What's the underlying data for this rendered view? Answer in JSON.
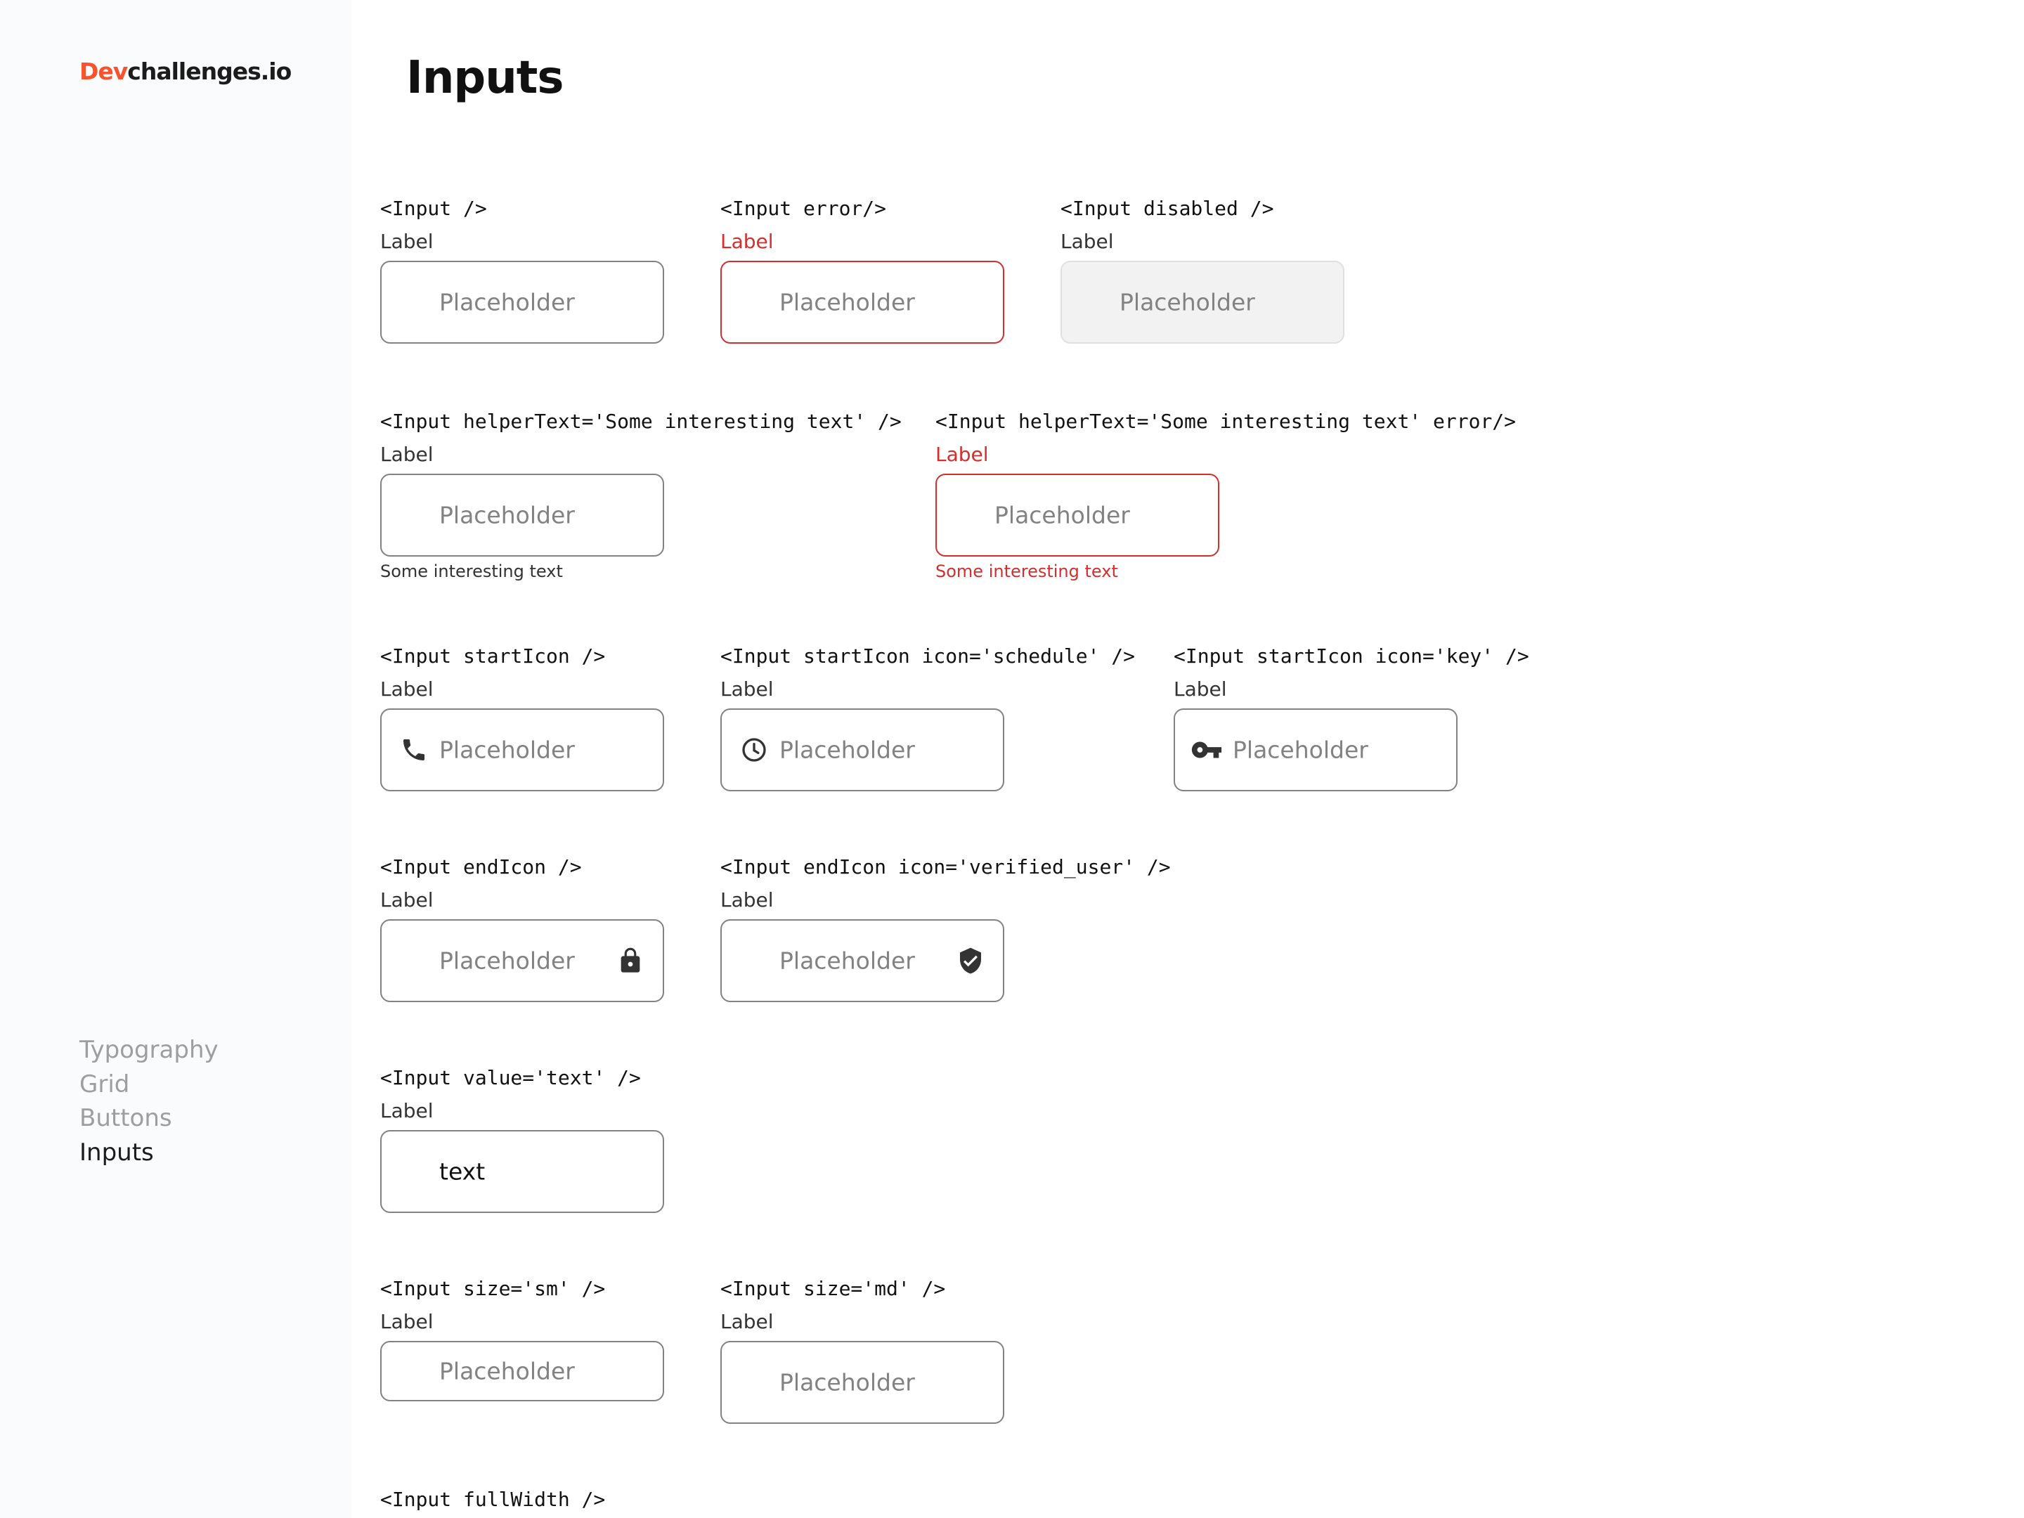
{
  "sidebar": {
    "logo_accent": "Dev",
    "logo_rest": "challenges.io",
    "nav": [
      {
        "label": "Typography"
      },
      {
        "label": "Grid"
      },
      {
        "label": "Buttons"
      },
      {
        "label": "Inputs"
      }
    ],
    "active_item": "Inputs"
  },
  "page": {
    "title": "Inputs"
  },
  "demos": {
    "basic": {
      "code": "<Input />",
      "label": "Label",
      "placeholder": "Placeholder"
    },
    "error": {
      "code": "<Input error/>",
      "label": "Label",
      "placeholder": "Placeholder"
    },
    "disabled": {
      "code": "<Input disabled />",
      "label": "Label",
      "placeholder": "Placeholder"
    },
    "helper": {
      "code": "<Input helperText='Some interesting text' />",
      "label": "Label",
      "placeholder": "Placeholder",
      "helper_text": "Some interesting text"
    },
    "helper_error": {
      "code": "<Input helperText='Some interesting text' error/>",
      "label": "Label",
      "placeholder": "Placeholder",
      "helper_text": "Some interesting text"
    },
    "start_icon": {
      "code": "<Input startIcon />",
      "label": "Label",
      "placeholder": "Placeholder",
      "icon": "phone-icon"
    },
    "start_icon_schedule": {
      "code": "<Input startIcon icon='schedule' />",
      "label": "Label",
      "placeholder": "Placeholder",
      "icon": "schedule-icon"
    },
    "start_icon_key": {
      "code": "<Input startIcon icon='key' />",
      "label": "Label",
      "placeholder": "Placeholder",
      "icon": "key-icon"
    },
    "end_icon": {
      "code": "<Input endIcon />",
      "label": "Label",
      "placeholder": "Placeholder",
      "icon": "lock-icon"
    },
    "end_icon_verified": {
      "code": "<Input endIcon icon='verified_user' />",
      "label": "Label",
      "placeholder": "Placeholder",
      "icon": "verified-user-icon"
    },
    "value": {
      "code": "<Input value='text' />",
      "label": "Label",
      "value": "text"
    },
    "size_sm": {
      "code": "<Input size='sm' />",
      "label": "Label",
      "placeholder": "Placeholder"
    },
    "size_md": {
      "code": "<Input size='md' />",
      "label": "Label",
      "placeholder": "Placeholder"
    },
    "full_width": {
      "code": "<Input fullWidth />"
    }
  },
  "colors": {
    "accent": "#f7542e",
    "error": "#d32f2f",
    "border": "#828282",
    "placeholder": "#828282",
    "sidebar_bg": "#fafbfd",
    "disabled_bg": "#f2f2f2"
  }
}
